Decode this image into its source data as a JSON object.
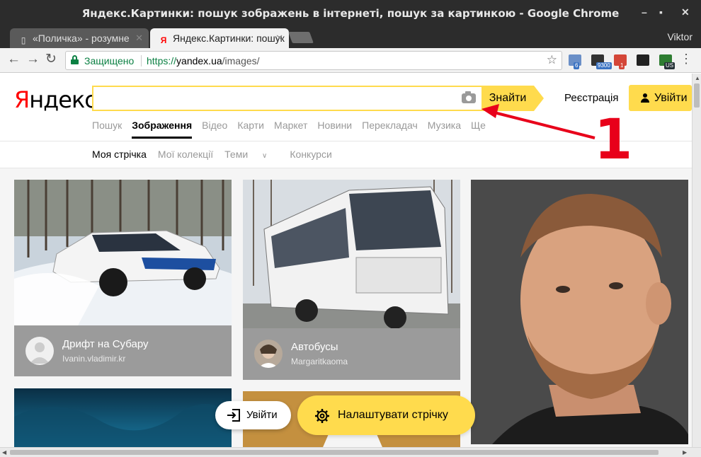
{
  "window": {
    "title": "Яндекс.Картинки: пошук зображень в інтернеті, пошук за картинкою - Google Chrome"
  },
  "tabs": [
    {
      "label": "«Поличка» - розумне",
      "active": false,
      "favicon": "page-icon"
    },
    {
      "label": "Яндекс.Картинки: пошук",
      "active": true,
      "favicon": "yandex-favicon-icon"
    }
  ],
  "profile": {
    "name": "Viktor"
  },
  "toolbar": {
    "secure_label": "Защищено",
    "url_scheme": "https://",
    "url_host": "yandex.ua",
    "url_path": "/images/",
    "extensions": [
      {
        "name": "mail-extension-icon",
        "badge": "6",
        "color": "#6a8fc7",
        "badge_color": "#3b73c2"
      },
      {
        "name": "counter-extension-icon",
        "badge": "9300",
        "color": "#333333",
        "badge_color": "#3b73c2"
      },
      {
        "name": "gmail-extension-icon",
        "badge": "1",
        "color": "#d44638",
        "badge_color": "#d44638"
      },
      {
        "name": "color-extension-icon",
        "badge": "",
        "color": "#222222",
        "badge_color": ""
      },
      {
        "name": "vpn-extension-icon",
        "badge": "US",
        "color": "#2e7d32",
        "badge_color": "#263238"
      }
    ]
  },
  "yandex": {
    "logo_first": "Я",
    "logo_rest": "ндекс",
    "search_value": "",
    "find_label": "Знайти",
    "register_label": "Реєстрація",
    "login_label": "Увійти",
    "services": [
      {
        "label": "Пошук",
        "active": false
      },
      {
        "label": "Зображення",
        "active": true
      },
      {
        "label": "Відео",
        "active": false
      },
      {
        "label": "Карти",
        "active": false
      },
      {
        "label": "Маркет",
        "active": false
      },
      {
        "label": "Новини",
        "active": false
      },
      {
        "label": "Перекладач",
        "active": false
      },
      {
        "label": "Музика",
        "active": false
      },
      {
        "label": "Ще",
        "active": false
      }
    ],
    "subnav": {
      "feed": "Моя стрічка",
      "collections": "Мої колекції",
      "themes": "Теми",
      "contests": "Конкурси"
    },
    "cards": [
      {
        "title": "Дрифт на Субару",
        "author": "Ivanin.vladimir.kr"
      },
      {
        "title": "Автобусы",
        "author": "Margaritkaoma"
      }
    ],
    "float_login_label": "Увійти",
    "tune_feed_label": "Налаштувати стрічку",
    "accent_color": "#ffdb4d"
  },
  "annotation": {
    "number": "1",
    "color": "#e8001a"
  }
}
